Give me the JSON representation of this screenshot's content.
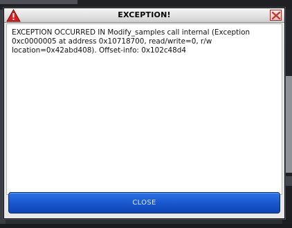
{
  "dialog": {
    "title": "EXCEPTION!",
    "message": "EXCEPTION OCCURRED IN Modify_samples call internal (Exception 0xc0000005 at address 0x10718700, read/write=0, r/w location=0x42abd408). Offset-info: 0x102c48d4",
    "close_button_label": "CLOSE",
    "title_icon": "warning-icon",
    "close_icon": "close-icon"
  },
  "colors": {
    "button_blue": "#1a58cf",
    "warning_red": "#d42020",
    "close_red": "#c0392b"
  }
}
